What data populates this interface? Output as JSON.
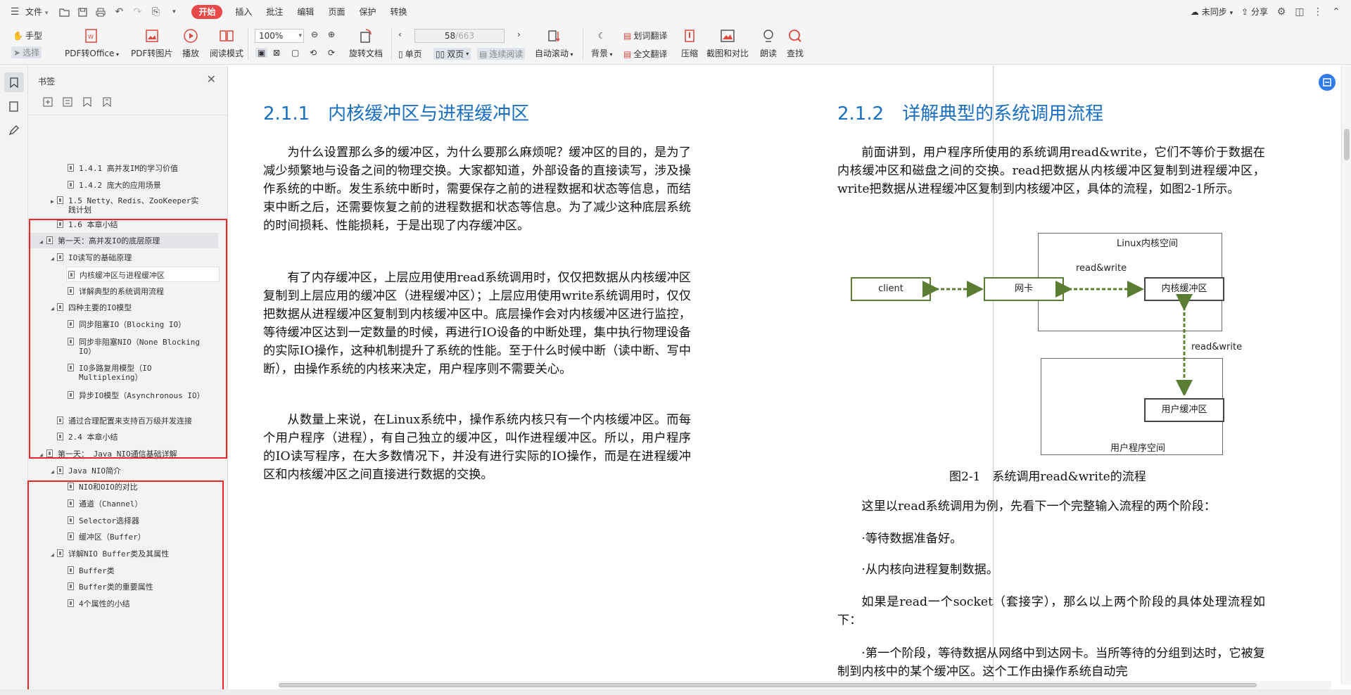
{
  "menubar": {
    "file_label": "文件",
    "tabs": [
      "开始",
      "插入",
      "批注",
      "编辑",
      "页面",
      "保护",
      "转换"
    ],
    "active_tab": "开始",
    "sync_label": "未同步",
    "share_label": "分享"
  },
  "ribbon": {
    "hand_label": "手型",
    "select_label": "选择",
    "pdf_to_office": "PDF转Office",
    "pdf_to_image": "PDF转图片",
    "play": "播放",
    "read_mode": "阅读模式",
    "zoom": "100%",
    "rotate_doc": "旋转文档",
    "page_current": "58",
    "page_total": "/663",
    "single_page": "单页",
    "double_page": "双页",
    "continuous_read": "连续阅读",
    "auto_scroll": "自动滚动",
    "background": "背景",
    "word_translate": "划词翻译",
    "full_translate": "全文翻译",
    "compress": "压缩",
    "screenshot_compare": "截图和对比",
    "read_aloud": "朗读",
    "find": "查找"
  },
  "bookmarks": {
    "title": "书签",
    "items": [
      {
        "text": "1.4.1 高并发IM的学习价值"
      },
      {
        "text": "1.4.2 庞大的应用场景"
      },
      {
        "text": "1.5 Netty、Redis、ZooKeeper实践计划"
      },
      {
        "text": "1.6 本章小结"
      },
      {
        "text": "第一天：高并发IO的底层原理"
      },
      {
        "text": "IO读写的基础原理"
      },
      {
        "text": "内核缓冲区与进程缓冲区"
      },
      {
        "text": "详解典型的系统调用流程"
      },
      {
        "text": "四种主要的IO模型"
      },
      {
        "text": "同步阻塞IO（Blocking IO）"
      },
      {
        "text": "同步非阻塞NIO（None Blocking IO）"
      },
      {
        "text": "IO多路复用模型（IO Multiplexing）"
      },
      {
        "text": "异步IO模型（Asynchronous IO）"
      },
      {
        "text": "通过合理配置来支持百万级并发连接"
      },
      {
        "text": "2.4 本章小结"
      },
      {
        "text": "第一天： Java NIO通信基础详解"
      },
      {
        "text": "Java NIO简介"
      },
      {
        "text": "NIO和OIO的对比"
      },
      {
        "text": "通道（Channel）"
      },
      {
        "text": "Selector选择器"
      },
      {
        "text": "缓冲区（Buffer）"
      },
      {
        "text": "详解NIO Buffer类及其属性"
      },
      {
        "text": "Buffer类"
      },
      {
        "text": "Buffer类的重要属性"
      },
      {
        "text": "4个属性的小结"
      }
    ]
  },
  "left_page": {
    "heading_num": "2.1.1",
    "heading_text": "内核缓冲区与进程缓冲区",
    "p1": "为什么设置那么多的缓冲区，为什么要那么麻烦呢？缓冲区的目的，是为了减少频繁地与设备之间的物理交换。大家都知道，外部设备的直接读写，涉及操作系统的中断。发生系统中断时，需要保存之前的进程数据和状态等信息，而结束中断之后，还需要恢复之前的进程数据和状态等信息。为了减少这种底层系统的时间损耗、性能损耗，于是出现了内存缓冲区。",
    "p2": "有了内存缓冲区，上层应用使用read系统调用时，仅仅把数据从内核缓冲区复制到上层应用的缓冲区（进程缓冲区）；上层应用使用write系统调用时，仅仅把数据从进程缓冲区复制到内核缓冲区中。底层操作会对内核缓冲区进行监控，等待缓冲区达到一定数量的时候，再进行IO设备的中断处理，集中执行物理设备的实际IO操作，这种机制提升了系统的性能。至于什么时候中断（读中断、写中断），由操作系统的内核来决定，用户程序则不需要关心。",
    "p3": "从数量上来说，在Linux系统中，操作系统内核只有一个内核缓冲区。而每个用户程序（进程），有自己独立的缓冲区，叫作进程缓冲区。所以，用户程序的IO读写程序，在大多数情况下，并没有进行实际的IO操作，而是在进程缓冲区和内核缓冲区之间直接进行数据的交换。"
  },
  "right_page": {
    "heading_num": "2.1.2",
    "heading_text": "详解典型的系统调用流程",
    "p1": "前面讲到，用户程序所使用的系统调用read&write，它们不等价于数据在内核缓冲区和磁盘之间的交换。read把数据从内核缓冲区复制到进程缓冲区，write把数据从进程缓冲区复制到内核缓冲区，具体的流程，如图2-1所示。",
    "figure": {
      "kernel_space": "Linux内核空间",
      "user_space": "用户程序空间",
      "client": "client",
      "nic": "网卡",
      "kernel_buffer": "内核缓冲区",
      "user_buffer": "用户缓冲区",
      "rw_top": "read&write",
      "rw_side": "read&write",
      "caption": "图2-1　系统调用read&write的流程"
    },
    "p2": "这里以read系统调用为例，先看下一个完整输入流程的两个阶段：",
    "p3": "·等待数据准备好。",
    "p4": "·从内核向进程复制数据。",
    "p5": "如果是read一个socket（套接字），那么以上两个阶段的具体处理流程如下：",
    "p6": "·第一个阶段，等待数据从网络中到达网卡。当所等待的分组到达时，它被复制到内核中的某个缓冲区。这个工作由操作系统自动完"
  },
  "colors": {
    "accent_red": "#e84a4a",
    "heading_blue": "#1a6fc0",
    "diagram_green": "#5b7c33",
    "highlight_red": "#e8262a"
  }
}
